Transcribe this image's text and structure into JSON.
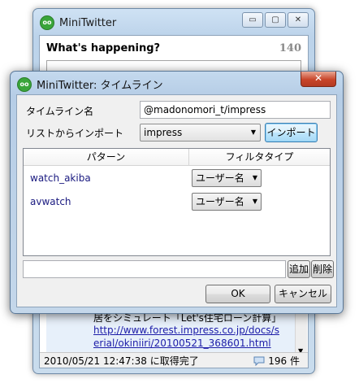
{
  "main_window": {
    "title": "MiniTwitter",
    "app_icon_text": "oo",
    "minimize_glyph": "▭",
    "maximize_glyph": "▢",
    "close_glyph": "✕",
    "compose_heading": "What's happening?",
    "char_counter": "140",
    "tweet_text": "居をシミュレート「Let's住宅ローン計算」",
    "tweet_link": "http://www.forest.impress.co.jp/docs/serial/okiniiri/20100521_368601.html",
    "scroll_down_glyph": "▼",
    "status_time": "2010/05/21 12:47:38 に取得完了",
    "status_count": "196 件"
  },
  "dialog": {
    "title": "MiniTwitter: タイムライン",
    "close_glyph": "✕",
    "timeline_name_label": "タイムライン名",
    "timeline_name_value": "@madonomori_t/impress",
    "import_label": "リストからインポート",
    "import_selected": "impress",
    "import_button": "インポート",
    "dropdown_glyph": "▼",
    "columns": [
      "パターン",
      "フィルタタイプ"
    ],
    "rows": [
      {
        "pattern": "watch_akiba",
        "filter_type": "ユーザー名"
      },
      {
        "pattern": "avwatch",
        "filter_type": "ユーザー名"
      }
    ],
    "add_button": "追加",
    "delete_button": "削除",
    "ok_button": "OK",
    "cancel_button": "キャンセル"
  }
}
